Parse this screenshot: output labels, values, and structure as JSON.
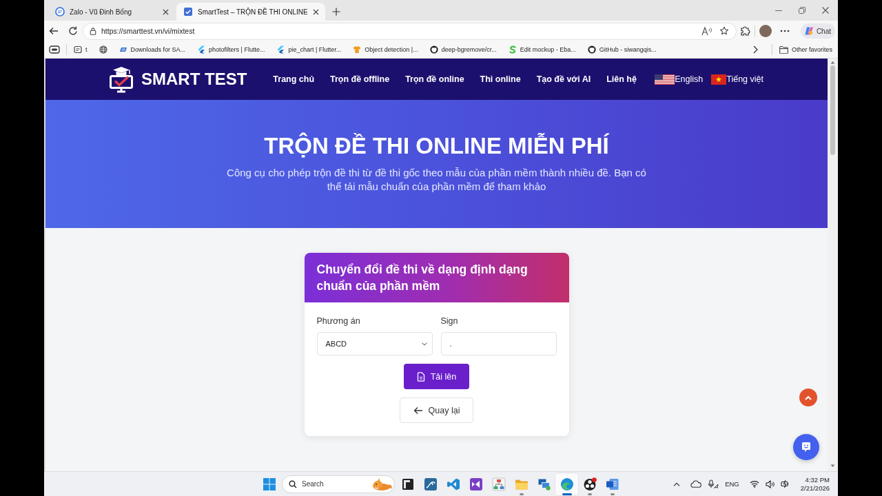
{
  "browser": {
    "tabs": [
      {
        "kind": "chat",
        "title": "Zalo - Vũ Đinh Bống",
        "selected": false
      },
      {
        "kind": "checklist",
        "title": "SmartTest – TRỘN ĐỀ THI ONLINE",
        "selected": true
      }
    ],
    "address": "https://smarttest.vn/vi/mixtest",
    "chat_button": "Chat",
    "bookmarks": [
      {
        "kind": "page",
        "label": "t"
      },
      {
        "kind": "globe"
      },
      {
        "kind": "stripes",
        "label": "Downloads for SA..."
      },
      {
        "kind": "chevron",
        "label": "photofilters | Flutte..."
      },
      {
        "kind": "chevron",
        "label": "pie_chart | Flutter..."
      },
      {
        "kind": "shirt",
        "label": "Object detection |..."
      },
      {
        "kind": "cat",
        "label": "deep-bgremove/cr..."
      },
      {
        "kind": "squiggle",
        "label": "Edit mockup - Eba..."
      },
      {
        "kind": "cat",
        "label": "GitHub - siwangqis..."
      }
    ],
    "other_favorites": "Other favorites"
  },
  "site": {
    "logo": "SMART TEST",
    "nav": [
      "Trang chủ",
      "Trọn đề offline",
      "Trọn đề online",
      "Thi online",
      "Tạo đề với AI",
      "Liên hệ"
    ],
    "languages": [
      {
        "kind": "en",
        "label": "English"
      },
      {
        "kind": "vi",
        "label": "Tiếng việt"
      }
    ]
  },
  "hero": {
    "title": "TRỘN ĐỀ THI ONLINE MIỄN PHÍ",
    "subtitle": "Công cụ cho phép trộn đề thi từ đề thi gốc theo mẫu của phần mềm thành nhiều đề. Bạn có thể tải mẫu chuẩn của phần mềm để tham khảo"
  },
  "card": {
    "title": "Chuyển đổi đề thi về dạng định dạng chuẩn của phần mềm",
    "fields": [
      {
        "kind": "select",
        "label": "Phương án",
        "value": "ABCD"
      },
      {
        "kind": "text",
        "label": "Sign",
        "value": "."
      }
    ],
    "buttons": [
      {
        "kind": "upload",
        "label": "Tải lên"
      },
      {
        "kind": "back",
        "label": "Quay lại"
      }
    ]
  },
  "taskbar": {
    "search_placeholder": "Search",
    "apps": [
      {
        "kind": "terminal",
        "running": false,
        "selected": false
      },
      {
        "kind": "database",
        "running": false,
        "selected": false
      },
      {
        "kind": "code",
        "running": false,
        "selected": false
      },
      {
        "kind": "ide",
        "running": false,
        "selected": false
      },
      {
        "kind": "diagram",
        "running": false,
        "selected": false
      },
      {
        "kind": "folder",
        "running": true,
        "selected": false
      },
      {
        "kind": "remote",
        "running": false,
        "selected": false
      },
      {
        "kind": "browser",
        "running": true,
        "selected": true
      },
      {
        "kind": "recorder",
        "running": true,
        "selected": false
      },
      {
        "kind": "mail",
        "running": true,
        "selected": false
      }
    ],
    "language": "ENG",
    "time": "4:32 PM",
    "date": "2/21/2026"
  }
}
